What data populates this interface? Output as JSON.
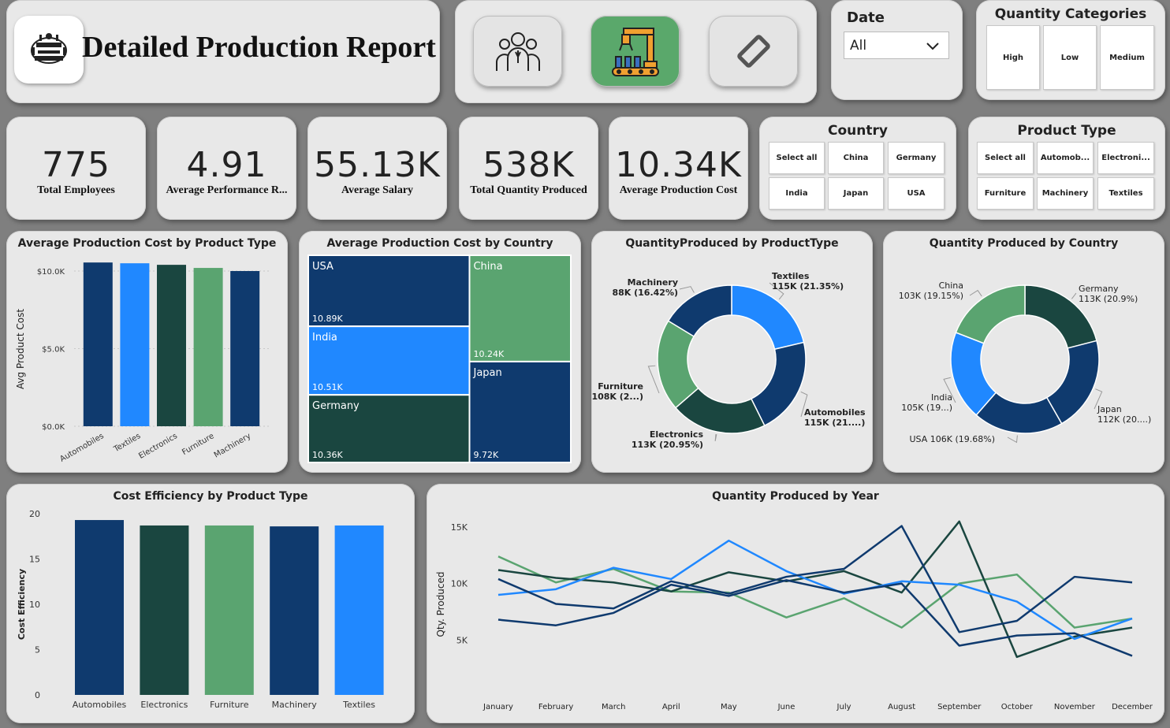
{
  "header": {
    "title": "Detailed Production Report"
  },
  "nav": {
    "buttons": [
      {
        "icon": "employees-icon",
        "active": false
      },
      {
        "icon": "production-robot-icon",
        "active": true
      },
      {
        "icon": "eraser-icon",
        "active": false
      }
    ]
  },
  "date_slicer": {
    "label": "Date",
    "value": "All"
  },
  "quantity_categories": {
    "title": "Quantity Categories",
    "options": [
      "High",
      "Low",
      "Medium"
    ]
  },
  "kpis": [
    {
      "value": "775",
      "label": "Total Employees"
    },
    {
      "value": "4.91",
      "label": "Average Performance R..."
    },
    {
      "value": "55.13K",
      "label": "Average Salary"
    },
    {
      "value": "538K",
      "label": "Total Quantity Produced"
    },
    {
      "value": "10.34K",
      "label": "Average Production Cost"
    }
  ],
  "country_slicer": {
    "title": "Country",
    "options": [
      "Select all",
      "China",
      "Germany",
      "India",
      "Japan",
      "USA"
    ]
  },
  "product_type_slicer": {
    "title": "Product Type",
    "options": [
      "Select all",
      "Automob...",
      "Electroni...",
      "Furniture",
      "Machinery",
      "Textiles"
    ]
  },
  "colors": {
    "dark_navy": "#0f3a6e",
    "bright_blue": "#2088ff",
    "dark_green": "#1a4640",
    "light_green": "#5aa470",
    "active_button": "#5aa86b"
  },
  "chart_data": [
    {
      "id": "avg_cost_by_product",
      "type": "bar",
      "title": "Average Production Cost by Product Type",
      "ylabel": "Avg Product Cost",
      "categories": [
        "Automobiles",
        "Textiles",
        "Electronics",
        "Furniture",
        "Machinery"
      ],
      "values": [
        10550,
        10500,
        10400,
        10200,
        10000
      ],
      "ylim": [
        0,
        10000
      ],
      "yticks": [
        0,
        5000,
        10000
      ],
      "ytick_labels": [
        "$0.0K",
        "$5.0K",
        "$10.0K"
      ],
      "colors": [
        "#0f3a6e",
        "#2088ff",
        "#1a4640",
        "#5aa470",
        "#0f3a6e"
      ],
      "grid": true
    },
    {
      "id": "avg_cost_by_country",
      "type": "treemap",
      "title": "Average Production Cost by Country",
      "items": [
        {
          "name": "USA",
          "value": 10.89,
          "label": "10.89K",
          "color": "#0f3a6e"
        },
        {
          "name": "China",
          "value": 10.24,
          "label": "10.24K",
          "color": "#5aa470"
        },
        {
          "name": "India",
          "value": 10.51,
          "label": "10.51K",
          "color": "#2088ff"
        },
        {
          "name": "Japan",
          "value": 9.72,
          "label": "9.72K",
          "color": "#0f3a6e"
        },
        {
          "name": "Germany",
          "value": 10.36,
          "label": "10.36K",
          "color": "#1a4640"
        }
      ]
    },
    {
      "id": "qty_by_product_type",
      "type": "pie",
      "title": "QuantityProduced by ProductType",
      "slices": [
        {
          "name": "Textiles",
          "value": 115,
          "label": "115K (21.35%)",
          "color": "#2088ff"
        },
        {
          "name": "Automobiles",
          "value": 115,
          "label": "115K (21....)",
          "color": "#0f3a6e"
        },
        {
          "name": "Electronics",
          "value": 113,
          "label": "113K (20.95%)",
          "color": "#1a4640"
        },
        {
          "name": "Furniture",
          "value": 108,
          "label": "108K (2...)",
          "color": "#5aa470"
        },
        {
          "name": "Machinery",
          "value": 88,
          "label": "88K (16.42%)",
          "color": "#0f3a6e"
        }
      ]
    },
    {
      "id": "qty_by_country",
      "type": "pie",
      "title": "Quantity Produced by Country",
      "slices": [
        {
          "name": "Germany",
          "value": 113,
          "label": "113K (20.9%)",
          "color": "#1a4640"
        },
        {
          "name": "Japan",
          "value": 112,
          "label": "112K (20....)",
          "color": "#0f3a6e"
        },
        {
          "name": "USA",
          "value": 106,
          "label": "USA 106K (19.68%)",
          "color": "#0f3a6e"
        },
        {
          "name": "India",
          "value": 105,
          "label": "105K (19...)",
          "color": "#2088ff"
        },
        {
          "name": "China",
          "value": 103,
          "label": "103K (19.15%)",
          "color": "#5aa470"
        }
      ]
    },
    {
      "id": "cost_efficiency_by_product",
      "type": "bar",
      "title": "Cost Efficiency by Product Type",
      "ylabel": "Cost Efficiency",
      "categories": [
        "Automobiles",
        "Electronics",
        "Furniture",
        "Machinery",
        "Textiles"
      ],
      "values": [
        19.3,
        18.7,
        18.7,
        18.6,
        18.7
      ],
      "ylim": [
        0,
        20
      ],
      "yticks": [
        0,
        5,
        10,
        15,
        20
      ],
      "colors": [
        "#0f3a6e",
        "#1a4640",
        "#5aa470",
        "#0f3a6e",
        "#2088ff"
      ],
      "grid": false
    },
    {
      "id": "qty_by_year",
      "type": "line",
      "title": "Quantity Produced by Year",
      "ylabel": "Qty. Produced",
      "x": [
        "January",
        "February",
        "March",
        "April",
        "May",
        "June",
        "July",
        "August",
        "September",
        "October",
        "November",
        "December"
      ],
      "ylim": [
        0,
        16000
      ],
      "yticks": [
        5000,
        10000,
        15000
      ],
      "ytick_labels": [
        "5K",
        "10K",
        "15K"
      ],
      "series": [
        {
          "color": "#5aa470",
          "values": [
            12400,
            10100,
            11300,
            9300,
            9200,
            7000,
            8700,
            6100,
            10000,
            10800,
            6100,
            6900
          ]
        },
        {
          "color": "#1a4640",
          "values": [
            11200,
            10500,
            10100,
            9300,
            11000,
            10200,
            11100,
            9200,
            15500,
            3500,
            5300,
            6100
          ]
        },
        {
          "color": "#2088ff",
          "values": [
            9000,
            9500,
            11400,
            10400,
            13800,
            11100,
            9100,
            10200,
            9900,
            8400,
            5100,
            6900
          ]
        },
        {
          "color": "#0f3a6e",
          "values": [
            10400,
            8200,
            7800,
            10200,
            9100,
            10600,
            11300,
            15100,
            5700,
            6700,
            10600,
            10100
          ]
        },
        {
          "color": "#0f3a6e",
          "values": [
            6800,
            6300,
            7400,
            9900,
            8900,
            10300,
            9200,
            10000,
            4500,
            5400,
            5600,
            3600
          ]
        }
      ]
    }
  ]
}
